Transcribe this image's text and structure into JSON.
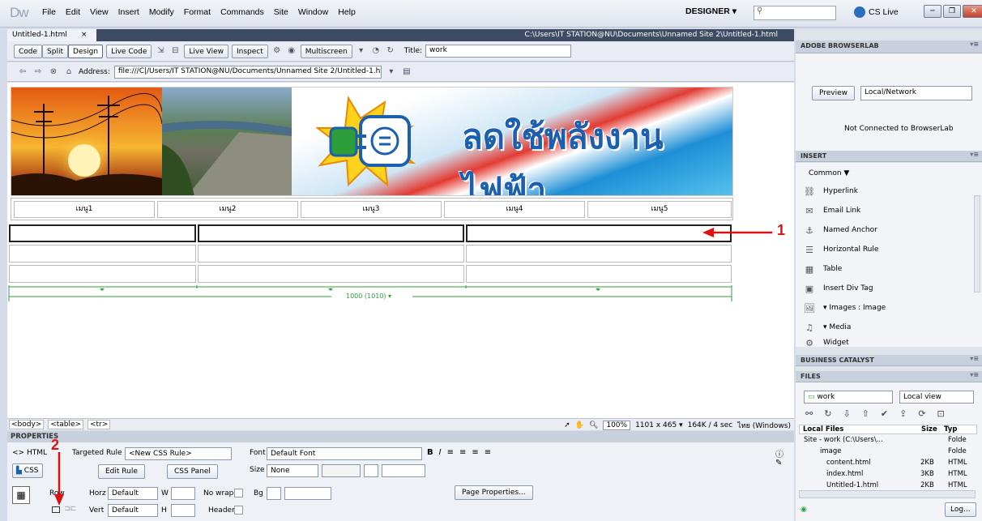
{
  "app": {
    "logo": "Dw",
    "menu": [
      "File",
      "Edit",
      "View",
      "Insert",
      "Modify",
      "Format",
      "Commands",
      "Site",
      "Window",
      "Help"
    ],
    "workspace": "DESIGNER ▾",
    "cslive": "CS Live"
  },
  "doc": {
    "tab": "Untitled-1.html",
    "tab_close": "×",
    "path": "C:\\Users\\IT STATION@NU\\Documents\\Unnamed Site 2\\Untitled-1.html"
  },
  "toolbar": {
    "code": "Code",
    "split": "Split",
    "design": "Design",
    "livecode": "Live Code",
    "liveview": "Live View",
    "inspect": "Inspect",
    "multiscreen": "Multiscreen",
    "title_label": "Title:",
    "title_value": "work"
  },
  "address": {
    "label": "Address:",
    "value": "file:///C|/Users/IT STATION@NU/Documents/Unnamed Site 2/Untitled-1.html"
  },
  "banner": {
    "text": "ลดใช้พลังงานไฟฟ้า"
  },
  "nav": [
    "เมนู1",
    "เมนู2",
    "เมนู3",
    "เมนู4",
    "เมนู5"
  ],
  "ruler": {
    "width_label": "1000 (1010) ▾"
  },
  "status": {
    "tags": [
      "<body>",
      "<table>",
      "<tr>"
    ],
    "zoom": "100%",
    "size": "1101 x 465 ▾",
    "download": "164K / 4 sec",
    "encoding": "ไทย (Windows)"
  },
  "properties": {
    "header": "PROPERTIES",
    "html_btn": "<> HTML",
    "css_btn": "CSS",
    "targeted_rule_label": "Targeted Rule",
    "targeted_rule_value": "<New CSS Rule>",
    "font_label": "Font",
    "font_value": "Default Font",
    "edit_rule": "Edit Rule",
    "css_panel": "CSS Panel",
    "size_label": "Size",
    "size_value": "None",
    "row_label": "Row",
    "horz_label": "Horz",
    "horz_value": "Default",
    "w_label": "W",
    "nowrap_label": "No wrap",
    "bg_label": "Bg",
    "page_props": "Page Properties...",
    "vert_label": "Vert",
    "vert_value": "Default",
    "h_label": "H",
    "header_label": "Header"
  },
  "browserlab": {
    "header": "ADOBE BROWSERLAB",
    "preview": "Preview",
    "local_network": "Local/Network",
    "status": "Not Connected to BrowserLab"
  },
  "insert": {
    "header": "INSERT",
    "category": "Common ▼",
    "items": [
      "Hyperlink",
      "Email Link",
      "Named Anchor",
      "Horizontal Rule",
      "Table",
      "Insert Div Tag",
      "▾ Images : Image",
      "▾ Media",
      "Widget"
    ]
  },
  "bc": {
    "header": "BUSINESS CATALYST"
  },
  "files": {
    "header": "FILES",
    "site": "work",
    "view": "Local view",
    "col_local": "Local Files",
    "col_size": "Size",
    "col_type": "Typ",
    "rows": [
      {
        "name": "Site - work (C:\\Users\\...",
        "size": "",
        "type": "Folde"
      },
      {
        "name": "image",
        "size": "",
        "type": "Folde"
      },
      {
        "name": "content.html",
        "size": "2KB",
        "type": "HTML"
      },
      {
        "name": "index.html",
        "size": "3KB",
        "type": "HTML"
      },
      {
        "name": "Untitled-1.html",
        "size": "2KB",
        "type": "HTML"
      }
    ],
    "log": "Log..."
  },
  "annotations": {
    "one": "1",
    "two": "2"
  }
}
